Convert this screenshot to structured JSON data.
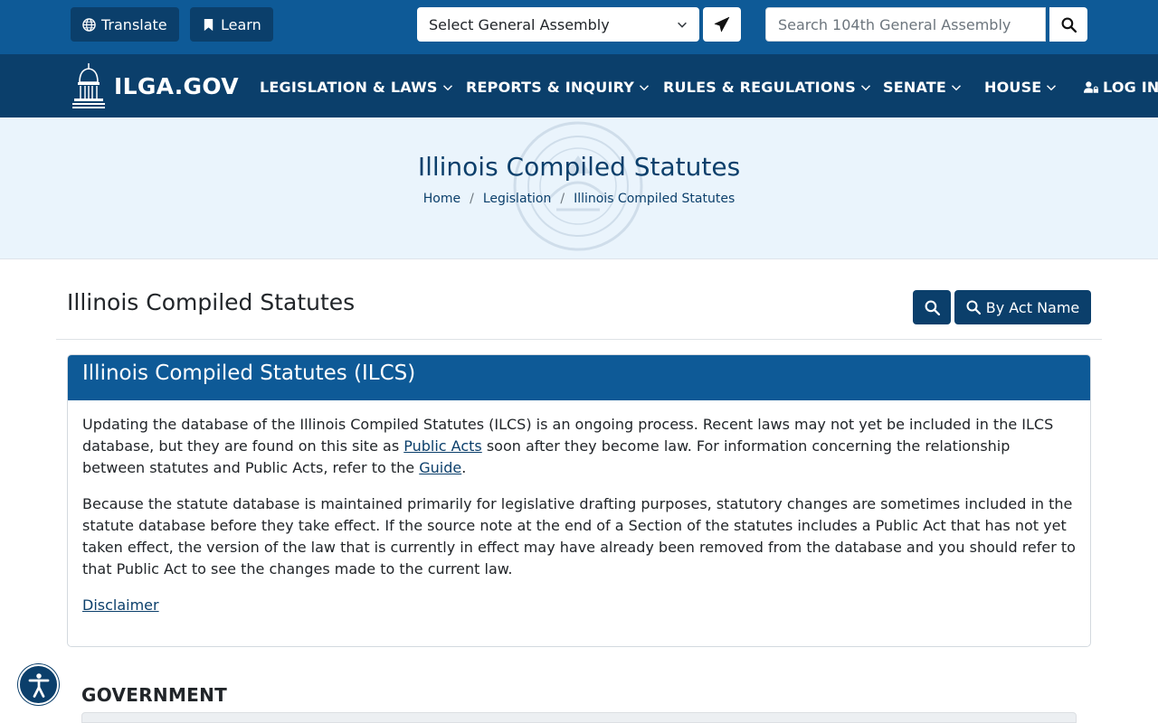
{
  "utility": {
    "translate_label": "Translate",
    "learn_label": "Learn",
    "assembly_select_value": "Select General Assembly",
    "search_placeholder": "Search 104th General Assembly"
  },
  "nav": {
    "logo_text": "ILGA.GOV",
    "items": [
      {
        "label": "LEGISLATION & LAWS"
      },
      {
        "label": "REPORTS & INQUIRY"
      },
      {
        "label": "RULES & REGULATIONS"
      },
      {
        "label": "SENATE"
      },
      {
        "label": "HOUSE"
      }
    ],
    "login_label": "LOG IN"
  },
  "hero": {
    "title": "Illinois Compiled Statutes",
    "breadcrumb": [
      "Home",
      "Legislation",
      "Illinois Compiled Statutes"
    ]
  },
  "page": {
    "title": "Illinois Compiled Statutes",
    "by_act_name_label": "By Act Name"
  },
  "card": {
    "heading": "Illinois Compiled Statutes (ILCS)",
    "p1_text1": "Updating the database of the Illinois Compiled Statutes (ILCS) is an ongoing process. Recent laws may not yet be included in the ILCS database, but they are found on this site as ",
    "p1_link1": "Public Acts",
    "p1_text2": " soon after they become law. For information concerning the relationship between statutes and Public Acts, refer to the ",
    "p1_link2": "Guide",
    "p1_text3": ".",
    "p2_text": "Because the statute database is maintained primarily for legislative drafting purposes, statutory changes are sometimes included in the statute database before they take effect. If the source note at the end of a Section of the statutes includes a Public Act that has not yet taken effect, the version of the law that is currently in effect may have already been removed from the database and you should refer to that Public Act to see the changes made to the current law.",
    "disclaimer_link": "Disclaimer"
  },
  "section": {
    "title": "GOVERNMENT"
  },
  "colors": {
    "utility_bar": "#0e5a97",
    "nav_bar": "#0b3f6b",
    "hero_bg": "#eaf4fc",
    "card_header": "#0e5a97"
  },
  "icons": {
    "translate": "globe-icon",
    "learn": "bookmark-icon",
    "select": "chevron-down-icon",
    "send": "paper-plane-icon",
    "search": "search-icon",
    "login": "user-lock-icon",
    "accessibility": "accessibility-icon"
  }
}
